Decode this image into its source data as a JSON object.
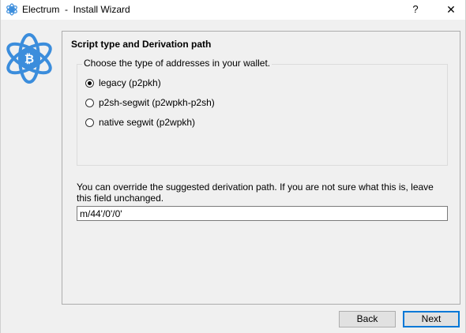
{
  "window": {
    "title": "Electrum  -  Install Wizard",
    "help_label": "?",
    "close_label": "✕"
  },
  "panel": {
    "title": "Script type and Derivation path"
  },
  "script_type": {
    "group_title": "Choose the type of addresses in your wallet.",
    "options": [
      {
        "label": "legacy (p2pkh)",
        "checked": true
      },
      {
        "label": "p2sh-segwit (p2wpkh-p2sh)",
        "checked": false
      },
      {
        "label": "native segwit (p2wpkh)",
        "checked": false
      }
    ]
  },
  "derivation": {
    "info": "You can override the suggested derivation path. If you are not sure what this is, leave this field unchanged.",
    "value": "m/44'/0'/0'"
  },
  "buttons": {
    "back": "Back",
    "next": "Next"
  },
  "colors": {
    "logo_blue": "#3b8ddc",
    "default_button_border": "#0078d7"
  },
  "icons": {
    "app_icon": "electrum-logo-icon",
    "logo": "electrum-bitcoin-atom-logo"
  }
}
